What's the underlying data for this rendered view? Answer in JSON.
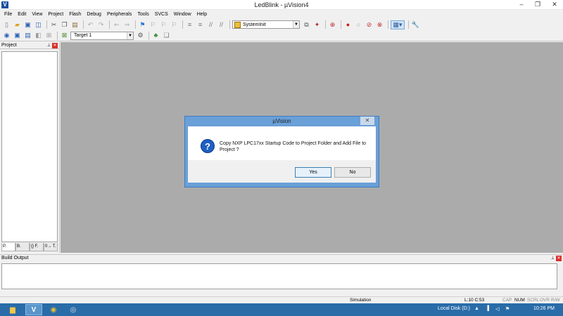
{
  "window": {
    "title": "LedBlink  -  µVision4",
    "minimize": "–",
    "maximize": "❐",
    "close": "✕"
  },
  "menu": [
    "File",
    "Edit",
    "View",
    "Project",
    "Flash",
    "Debug",
    "Peripherals",
    "Tools",
    "SVCS",
    "Window",
    "Help"
  ],
  "toolbar": {
    "function_combo": "SystemInit",
    "target_combo": "Target 1"
  },
  "project_panel": {
    "title": "Project",
    "tabs": [
      "P.",
      "B.",
      "{} F.",
      "0→ T."
    ]
  },
  "build_output": {
    "title": "Build Output"
  },
  "statusbar": {
    "mode": "Simulation",
    "position": "L:10 C:53",
    "cap": "CAP",
    "num": "NUM",
    "scrl": "SCRL",
    "ovr": "OVR",
    "rw": "R/W"
  },
  "dialog": {
    "title": "µVision",
    "message": "Copy NXP LPC17xx Startup Code to Project Folder and Add File to Project ?",
    "yes": "Yes",
    "no": "No",
    "close": "✕"
  },
  "taskbar": {
    "drive": "Local Disk (D:)",
    "time": "10:26 PM"
  },
  "colors": {
    "workspace": "#ababab",
    "taskbar": "#2a6ca8",
    "dialog_frame": "#6aa0d8"
  }
}
